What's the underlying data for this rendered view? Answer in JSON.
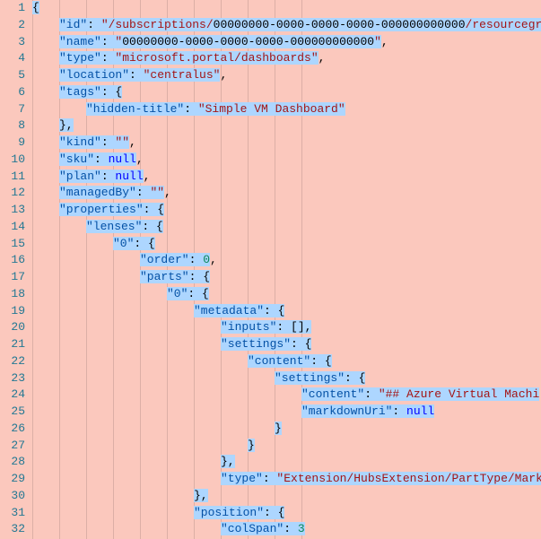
{
  "gutter": {
    "lines": [
      "1",
      "2",
      "3",
      "4",
      "5",
      "6",
      "7",
      "8",
      "9",
      "10",
      "11",
      "12",
      "13",
      "14",
      "15",
      "16",
      "17",
      "18",
      "19",
      "20",
      "21",
      "22",
      "23",
      "24",
      "25",
      "26",
      "27",
      "28",
      "29",
      "30",
      "31",
      "32"
    ]
  },
  "code": {
    "lines": [
      {
        "indent": 0,
        "segments": [
          {
            "c": "pun",
            "t": "{",
            "hl": true
          }
        ],
        "fold": true
      },
      {
        "indent": 1,
        "segments": [
          {
            "c": "key",
            "t": "\"id\"",
            "hl": true
          },
          {
            "c": "pun",
            "t": ": ",
            "hl": true
          },
          {
            "c": "str",
            "t": "\"/subscriptions/",
            "hl": true
          },
          {
            "c": "raw",
            "t": "00000000-0000-0000-0000-000000000000",
            "hl": true
          },
          {
            "c": "str",
            "t": "/resourcegroups",
            "hl": true
          }
        ]
      },
      {
        "indent": 1,
        "segments": [
          {
            "c": "key",
            "t": "\"name\"",
            "hl": true
          },
          {
            "c": "pun",
            "t": ": ",
            "hl": true
          },
          {
            "c": "str",
            "t": "\"",
            "hl": true
          },
          {
            "c": "raw",
            "t": "00000000-0000-0000-0000-000000000000",
            "hl": true
          },
          {
            "c": "str",
            "t": "\"",
            "hl": true
          },
          {
            "c": "pun",
            "t": ",",
            "hl": false
          }
        ]
      },
      {
        "indent": 1,
        "segments": [
          {
            "c": "key",
            "t": "\"type\"",
            "hl": true
          },
          {
            "c": "pun",
            "t": ": ",
            "hl": true
          },
          {
            "c": "str",
            "t": "\"microsoft.portal/dashboards\"",
            "hl": true
          },
          {
            "c": "pun",
            "t": ",",
            "hl": false
          }
        ]
      },
      {
        "indent": 1,
        "segments": [
          {
            "c": "key",
            "t": "\"location\"",
            "hl": true
          },
          {
            "c": "pun",
            "t": ": ",
            "hl": true
          },
          {
            "c": "str",
            "t": "\"centralus\"",
            "hl": true
          },
          {
            "c": "pun",
            "t": ",",
            "hl": false
          }
        ]
      },
      {
        "indent": 1,
        "segments": [
          {
            "c": "key",
            "t": "\"tags\"",
            "hl": true
          },
          {
            "c": "pun",
            "t": ": {",
            "hl": true
          }
        ]
      },
      {
        "indent": 2,
        "segments": [
          {
            "c": "key",
            "t": "\"hidden-title\"",
            "hl": true
          },
          {
            "c": "pun",
            "t": ": ",
            "hl": true
          },
          {
            "c": "str",
            "t": "\"Simple VM Dashboard\"",
            "hl": true
          }
        ]
      },
      {
        "indent": 1,
        "segments": [
          {
            "c": "pun",
            "t": "},",
            "hl": true
          }
        ]
      },
      {
        "indent": 1,
        "segments": [
          {
            "c": "key",
            "t": "\"kind\"",
            "hl": true
          },
          {
            "c": "pun",
            "t": ": ",
            "hl": true
          },
          {
            "c": "str",
            "t": "\"\"",
            "hl": true
          },
          {
            "c": "pun",
            "t": ",",
            "hl": false
          }
        ]
      },
      {
        "indent": 1,
        "segments": [
          {
            "c": "key",
            "t": "\"sku\"",
            "hl": true
          },
          {
            "c": "pun",
            "t": ": ",
            "hl": true
          },
          {
            "c": "kw",
            "t": "null",
            "hl": true
          },
          {
            "c": "pun",
            "t": ",",
            "hl": false
          }
        ]
      },
      {
        "indent": 1,
        "segments": [
          {
            "c": "key",
            "t": "\"plan\"",
            "hl": true
          },
          {
            "c": "pun",
            "t": ": ",
            "hl": true
          },
          {
            "c": "kw",
            "t": "null",
            "hl": true
          },
          {
            "c": "pun",
            "t": ",",
            "hl": false
          }
        ]
      },
      {
        "indent": 1,
        "segments": [
          {
            "c": "key",
            "t": "\"managedBy\"",
            "hl": true
          },
          {
            "c": "pun",
            "t": ": ",
            "hl": true
          },
          {
            "c": "str",
            "t": "\"\"",
            "hl": true
          },
          {
            "c": "pun",
            "t": ",",
            "hl": false
          }
        ]
      },
      {
        "indent": 1,
        "segments": [
          {
            "c": "key",
            "t": "\"properties\"",
            "hl": true
          },
          {
            "c": "pun",
            "t": ": {",
            "hl": true
          }
        ]
      },
      {
        "indent": 2,
        "segments": [
          {
            "c": "key",
            "t": "\"lenses\"",
            "hl": true
          },
          {
            "c": "pun",
            "t": ": {",
            "hl": true
          }
        ]
      },
      {
        "indent": 3,
        "segments": [
          {
            "c": "key",
            "t": "\"0\"",
            "hl": true
          },
          {
            "c": "pun",
            "t": ": {",
            "hl": true
          }
        ]
      },
      {
        "indent": 4,
        "segments": [
          {
            "c": "key",
            "t": "\"order\"",
            "hl": true
          },
          {
            "c": "pun",
            "t": ": ",
            "hl": true
          },
          {
            "c": "num",
            "t": "0",
            "hl": true
          },
          {
            "c": "pun",
            "t": ",",
            "hl": false
          }
        ]
      },
      {
        "indent": 4,
        "segments": [
          {
            "c": "key",
            "t": "\"parts\"",
            "hl": true
          },
          {
            "c": "pun",
            "t": ": {",
            "hl": true
          }
        ]
      },
      {
        "indent": 5,
        "segments": [
          {
            "c": "key",
            "t": "\"0\"",
            "hl": true
          },
          {
            "c": "pun",
            "t": ": {",
            "hl": true
          }
        ]
      },
      {
        "indent": 6,
        "segments": [
          {
            "c": "key",
            "t": "\"metadata\"",
            "hl": true
          },
          {
            "c": "pun",
            "t": ": {",
            "hl": true
          }
        ]
      },
      {
        "indent": 7,
        "segments": [
          {
            "c": "key",
            "t": "\"inputs\"",
            "hl": true
          },
          {
            "c": "pun",
            "t": ": [],",
            "hl": true
          }
        ]
      },
      {
        "indent": 7,
        "segments": [
          {
            "c": "key",
            "t": "\"settings\"",
            "hl": true
          },
          {
            "c": "pun",
            "t": ": {",
            "hl": true
          }
        ]
      },
      {
        "indent": 8,
        "segments": [
          {
            "c": "key",
            "t": "\"content\"",
            "hl": true
          },
          {
            "c": "pun",
            "t": ": {",
            "hl": true
          }
        ]
      },
      {
        "indent": 9,
        "segments": [
          {
            "c": "key",
            "t": "\"settings\"",
            "hl": true
          },
          {
            "c": "pun",
            "t": ": {",
            "hl": true
          }
        ]
      },
      {
        "indent": 10,
        "segments": [
          {
            "c": "key",
            "t": "\"content\"",
            "hl": true
          },
          {
            "c": "pun",
            "t": ": ",
            "hl": true
          },
          {
            "c": "str",
            "t": "\"## Azure Virtual Machi",
            "hl": true
          }
        ]
      },
      {
        "indent": 10,
        "segments": [
          {
            "c": "key",
            "t": "\"markdownUri\"",
            "hl": true
          },
          {
            "c": "pun",
            "t": ": ",
            "hl": true
          },
          {
            "c": "kw",
            "t": "null",
            "hl": true
          }
        ]
      },
      {
        "indent": 9,
        "segments": [
          {
            "c": "pun",
            "t": "}",
            "hl": true
          }
        ]
      },
      {
        "indent": 8,
        "segments": [
          {
            "c": "pun",
            "t": "}",
            "hl": true
          }
        ]
      },
      {
        "indent": 7,
        "segments": [
          {
            "c": "pun",
            "t": "},",
            "hl": true
          }
        ]
      },
      {
        "indent": 7,
        "segments": [
          {
            "c": "key",
            "t": "\"type\"",
            "hl": true
          },
          {
            "c": "pun",
            "t": ": ",
            "hl": true
          },
          {
            "c": "str",
            "t": "\"Extension/HubsExtension/PartType/Mark",
            "hl": true
          }
        ]
      },
      {
        "indent": 6,
        "segments": [
          {
            "c": "pun",
            "t": "},",
            "hl": true
          }
        ]
      },
      {
        "indent": 6,
        "segments": [
          {
            "c": "key",
            "t": "\"position\"",
            "hl": true
          },
          {
            "c": "pun",
            "t": ": {",
            "hl": true
          }
        ]
      },
      {
        "indent": 7,
        "segments": [
          {
            "c": "key",
            "t": "\"colSpan\"",
            "hl": true
          },
          {
            "c": "pun",
            "t": ": ",
            "hl": true
          },
          {
            "c": "num",
            "t": "3",
            "hl": true
          }
        ]
      }
    ]
  },
  "indentWidth": 30,
  "maxIndentGuides": 10
}
